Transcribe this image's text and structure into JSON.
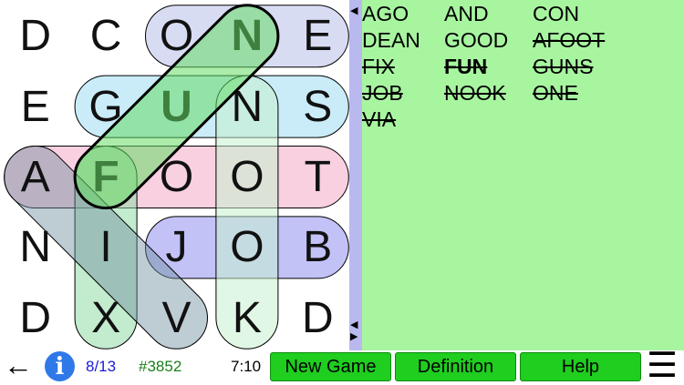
{
  "grid": [
    [
      "D",
      "C",
      "O",
      "N",
      "E"
    ],
    [
      "E",
      "G",
      "U",
      "N",
      "S"
    ],
    [
      "A",
      "F",
      "O",
      "O",
      "T"
    ],
    [
      "N",
      "I",
      "J",
      "O",
      "B"
    ],
    [
      "D",
      "X",
      "V",
      "K",
      "D"
    ]
  ],
  "bold_cells": [
    "0-3",
    "1-2",
    "2-1"
  ],
  "words": [
    {
      "text": "AGO",
      "found": false,
      "bold": false
    },
    {
      "text": "AND",
      "found": false,
      "bold": false
    },
    {
      "text": "CON",
      "found": false,
      "bold": false
    },
    {
      "text": "DEAN",
      "found": false,
      "bold": false
    },
    {
      "text": "GOOD",
      "found": false,
      "bold": false
    },
    {
      "text": "AFOOT",
      "found": true,
      "bold": false
    },
    {
      "text": "FIX",
      "found": true,
      "bold": false
    },
    {
      "text": "FUN",
      "found": true,
      "bold": true
    },
    {
      "text": "GUNS",
      "found": true,
      "bold": false
    },
    {
      "text": "JOB",
      "found": true,
      "bold": false
    },
    {
      "text": "NOOK",
      "found": true,
      "bold": false
    },
    {
      "text": "ONE",
      "found": true,
      "bold": false
    },
    {
      "text": "VIA",
      "found": true,
      "bold": false
    }
  ],
  "divider": {
    "arrow_top": "◀",
    "arrow_bottom_1": "◀",
    "arrow_bottom_2": "▶"
  },
  "status": {
    "back_icon": "←",
    "info_icon": "i",
    "progress": "8/13",
    "puzzle_number": "#3852",
    "timer": "7:10"
  },
  "buttons": {
    "new_game": "New Game",
    "definition": "Definition",
    "help": "Help"
  },
  "menu_icon": "☰",
  "colors": {
    "board_bg": "#ffffff",
    "word_panel_bg": "#a8f5a0",
    "divider": "#b9b9f0",
    "button": "#1fce1f",
    "progress_text": "#1b1bd6",
    "puzzle_text": "#1a7f1a",
    "info_circle": "#2f78e8"
  }
}
